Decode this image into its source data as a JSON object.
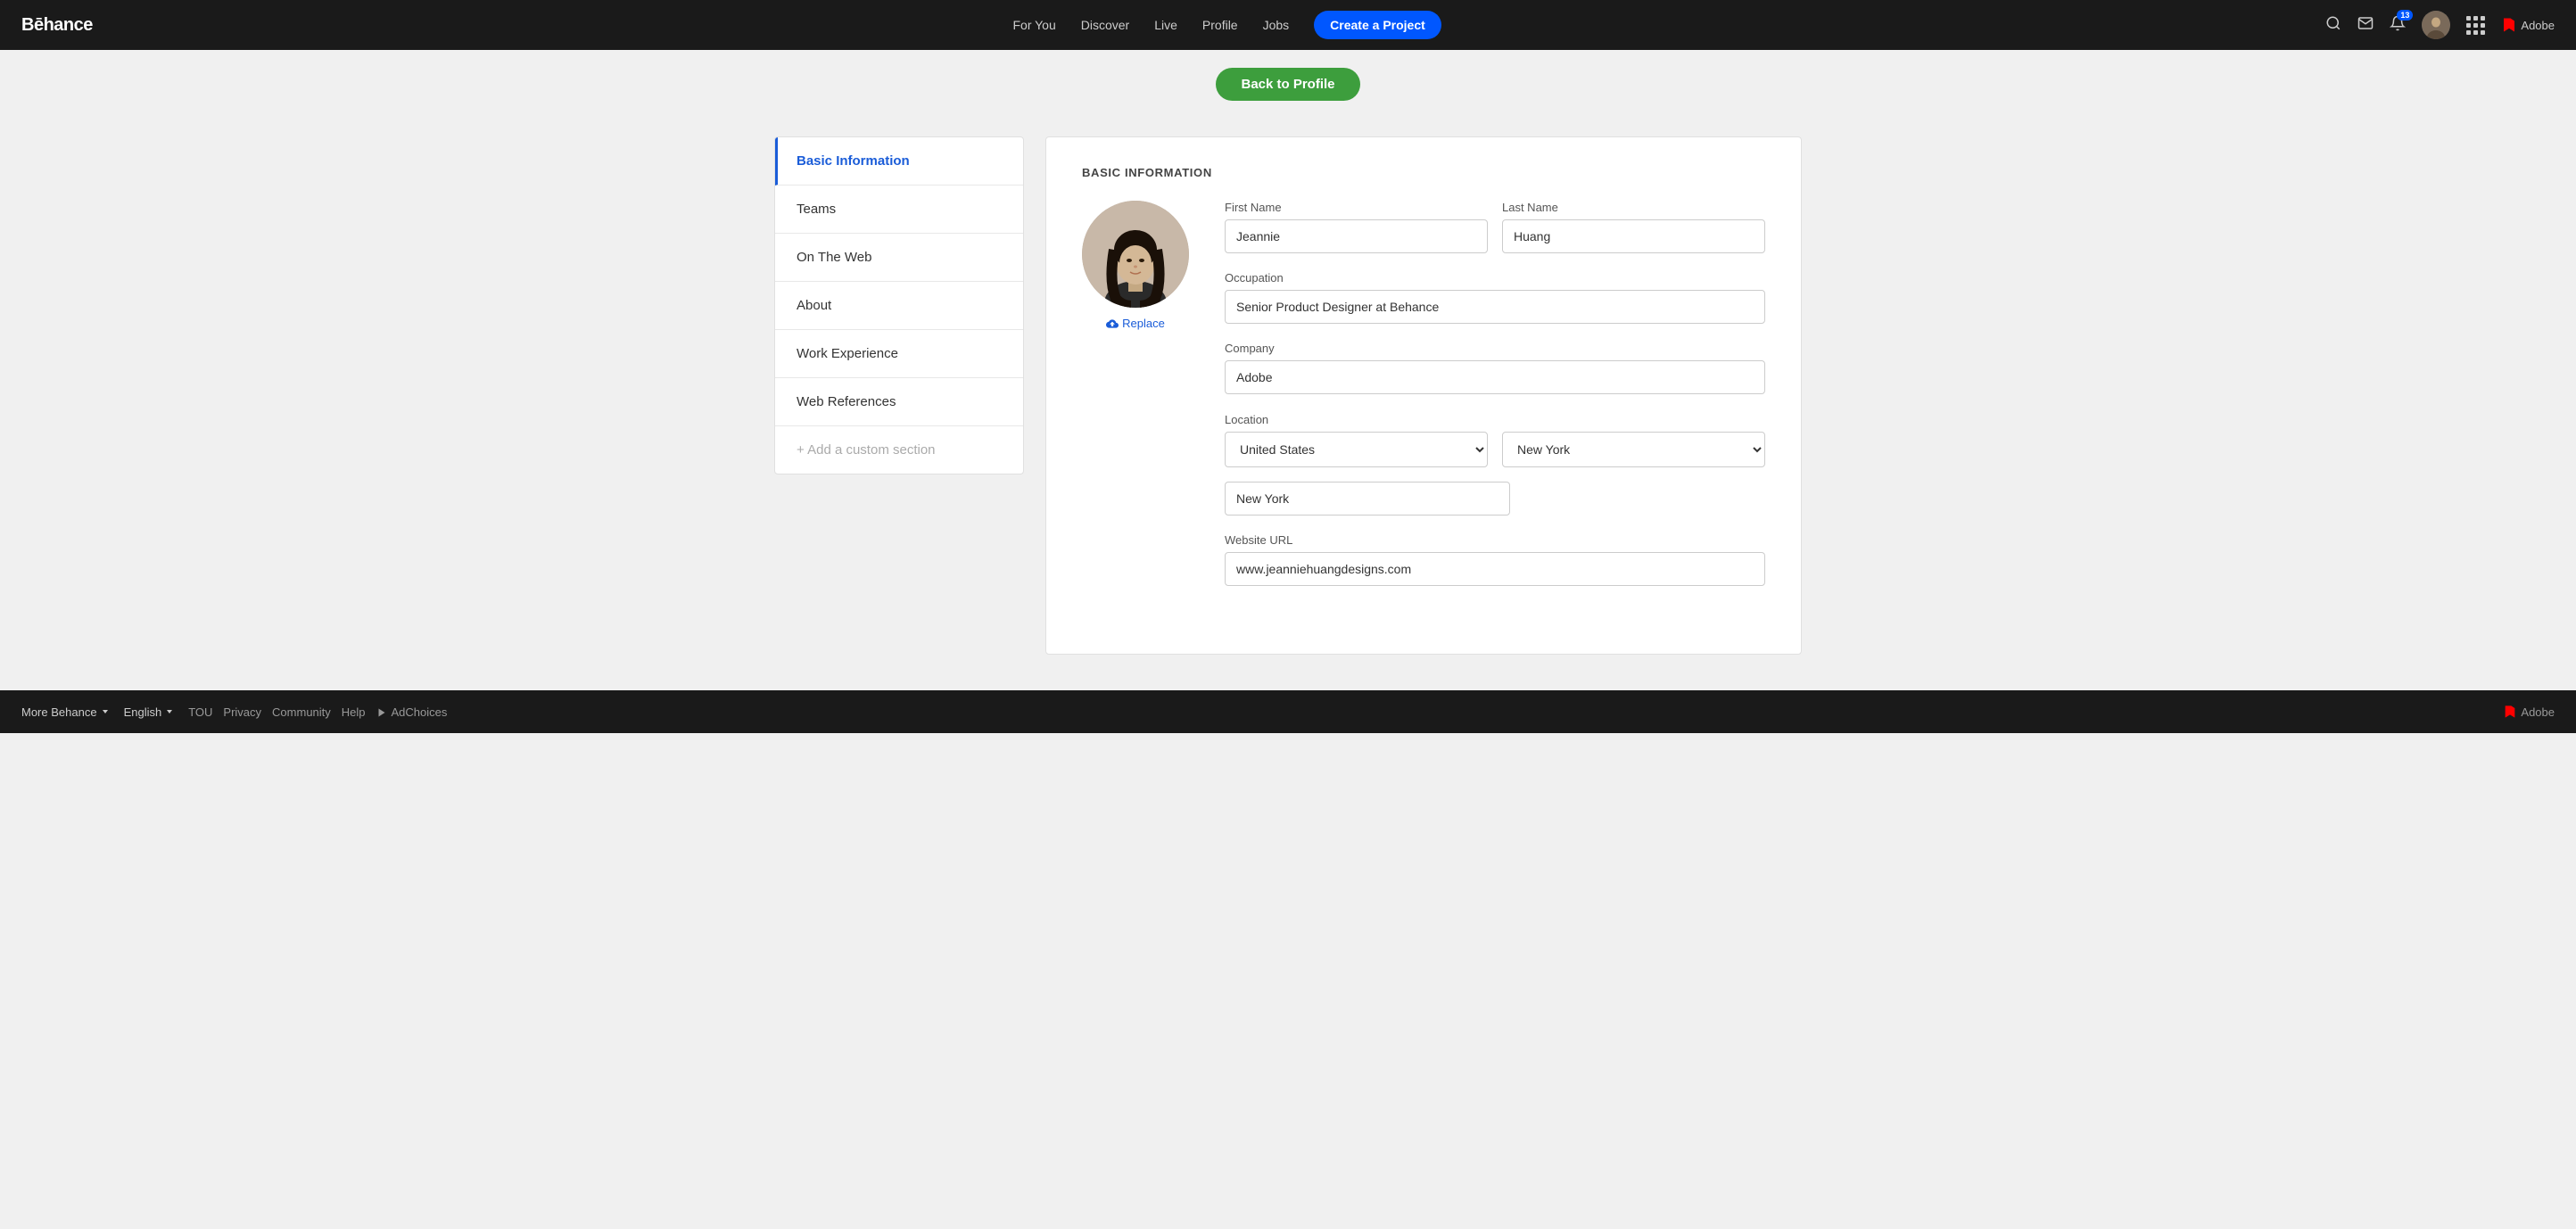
{
  "navbar": {
    "brand": "Bēhance",
    "nav_items": [
      "For You",
      "Discover",
      "Live",
      "Profile",
      "Jobs"
    ],
    "create_label": "Create a Project",
    "notification_count": "13",
    "adobe_label": "Adobe"
  },
  "back_button": "Back to Profile",
  "sidebar": {
    "items": [
      {
        "id": "basic-information",
        "label": "Basic Information",
        "active": true
      },
      {
        "id": "teams",
        "label": "Teams",
        "active": false
      },
      {
        "id": "on-the-web",
        "label": "On The Web",
        "active": false
      },
      {
        "id": "about",
        "label": "About",
        "active": false
      },
      {
        "id": "work-experience",
        "label": "Work Experience",
        "active": false
      },
      {
        "id": "web-references",
        "label": "Web References",
        "active": false
      }
    ],
    "add_custom": "+ Add a custom section"
  },
  "form": {
    "section_title": "BASIC INFORMATION",
    "replace_label": "Replace",
    "fields": {
      "first_name_label": "First Name",
      "first_name_value": "Jeannie",
      "last_name_label": "Last Name",
      "last_name_value": "Huang",
      "occupation_label": "Occupation",
      "occupation_value": "Senior Product Designer at Behance",
      "company_label": "Company",
      "company_value": "Adobe",
      "location_label": "Location",
      "country_value": "United States",
      "state_value": "New York",
      "city_value": "New York",
      "website_label": "Website URL",
      "website_value": "www.jeanniehuangdesigns.com"
    }
  },
  "footer": {
    "more_label": "More Behance",
    "language_label": "English",
    "links": [
      "TOU",
      "Privacy",
      "Community",
      "Help",
      "AdChoices"
    ],
    "adobe_label": "Adobe"
  }
}
